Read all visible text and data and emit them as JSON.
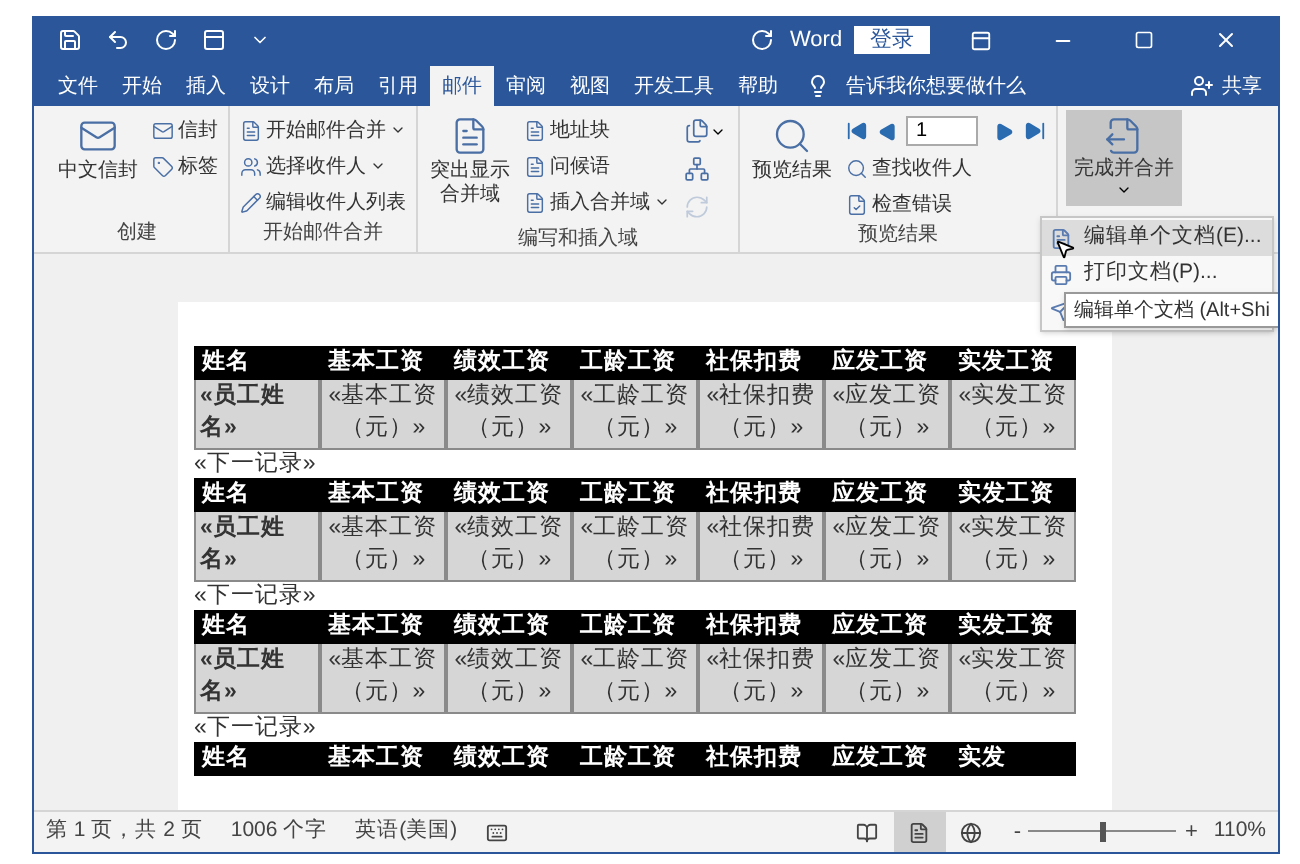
{
  "title_bar": {
    "app": "Word",
    "sign_in": "登录"
  },
  "tabs": [
    {
      "label": "文件",
      "selected": false
    },
    {
      "label": "开始",
      "selected": false
    },
    {
      "label": "插入",
      "selected": false
    },
    {
      "label": "设计",
      "selected": false
    },
    {
      "label": "布局",
      "selected": false
    },
    {
      "label": "引用",
      "selected": false
    },
    {
      "label": "邮件",
      "selected": true
    },
    {
      "label": "审阅",
      "selected": false
    },
    {
      "label": "视图",
      "selected": false
    },
    {
      "label": "开发工具",
      "selected": false
    },
    {
      "label": "帮助",
      "selected": false
    }
  ],
  "tell_me": "告诉我你想要做什么",
  "share": "共享",
  "ribbon": {
    "groups": [
      {
        "label": "创建",
        "columns": [
          [
            {
              "kind": "large",
              "label": "中文信封"
            }
          ],
          [
            {
              "kind": "small",
              "label": "信封"
            },
            {
              "kind": "small",
              "label": "标签"
            }
          ]
        ]
      },
      {
        "label": "开始邮件合并",
        "columns": [
          [
            {
              "kind": "small_menu",
              "label": "开始邮件合并"
            },
            {
              "kind": "small_menu",
              "label": "选择收件人"
            },
            {
              "kind": "small",
              "label": "编辑收件人列表"
            }
          ]
        ]
      },
      {
        "label": "编写和插入域",
        "columns": [
          [
            {
              "kind": "large",
              "label": "突出显示合并域"
            }
          ],
          [
            {
              "kind": "small",
              "label": "地址块"
            },
            {
              "kind": "small",
              "label": "问候语"
            },
            {
              "kind": "small_menu",
              "label": "插入合并域"
            }
          ],
          [
            {
              "kind": "icon_menu",
              "disabled": false
            },
            {
              "kind": "icon",
              "disabled": false
            },
            {
              "kind": "icon",
              "disabled": true
            }
          ]
        ]
      },
      {
        "label": "预览结果",
        "columns": [
          [
            {
              "kind": "large",
              "label": "预览结果"
            }
          ],
          [
            {
              "kind": "nav",
              "value": "1"
            },
            {
              "kind": "small",
              "label": "查找收件人"
            },
            {
              "kind": "small",
              "label": "检查错误"
            }
          ]
        ]
      }
    ],
    "finish": {
      "label": "完成并合并",
      "pressed": true
    }
  },
  "menu": {
    "items": [
      {
        "label": "编辑单个文档(E)...",
        "selected": true
      },
      {
        "label": "打印文档(P)...",
        "selected": false
      },
      {
        "selected": false
      }
    ]
  },
  "tooltip": "编辑单个文档 (Alt+Shi",
  "document": {
    "records": [
      {
        "header": [
          "姓名",
          "基本工资",
          "绩效工资",
          "工龄工资",
          "社保扣费",
          "应发工资",
          "实发工资"
        ],
        "cells": [
          "«员工姓名»",
          "«基本工资（元）»",
          "«绩效工资（元）»",
          "«工龄工资（元）»",
          "«社保扣费（元）»",
          "«应发工资（元）»",
          "«实发工资（元）»"
        ],
        "next": "«下一记录»"
      },
      {
        "header": [
          "姓名",
          "基本工资",
          "绩效工资",
          "工龄工资",
          "社保扣费",
          "应发工资",
          "实发工资"
        ],
        "cells": [
          "«员工姓名»",
          "«基本工资（元）»",
          "«绩效工资（元）»",
          "«工龄工资（元）»",
          "«社保扣费（元）»",
          "«应发工资（元）»",
          "«实发工资（元）»"
        ],
        "next": "«下一记录»"
      },
      {
        "header": [
          "姓名",
          "基本工资",
          "绩效工资",
          "工龄工资",
          "社保扣费",
          "应发工资",
          "实发工资"
        ],
        "cells": [
          "«员工姓名»",
          "«基本工资（元）»",
          "«绩效工资（元）»",
          "«工龄工资（元）»",
          "«社保扣费（元）»",
          "«应发工资（元）»",
          "«实发工资（元）»"
        ],
        "next": "«下一记录»"
      },
      {
        "header": [
          "姓名",
          "基本工资",
          "绩效工资",
          "工龄工资",
          "社保扣费",
          "应发工资",
          "实发"
        ]
      }
    ]
  },
  "status_bar": {
    "page": "第 1 页，共 2 页",
    "words": "1006 个字",
    "language": "英语(美国)",
    "views": [
      {
        "selected": false
      },
      {
        "selected": true
      },
      {
        "selected": false
      }
    ],
    "zoom_out": "-",
    "zoom_in": "+",
    "zoom": {
      "level": 0.5
    },
    "zoom_label": "110%"
  }
}
